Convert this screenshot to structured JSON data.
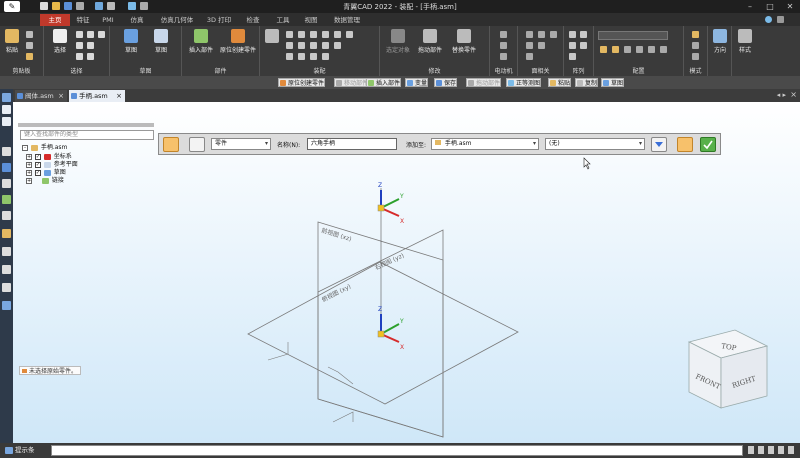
{
  "app": {
    "title": "青翼CAD 2022 - 装配 - [手柄.asm]"
  },
  "ribbon_tabs": [
    "主页",
    "特征",
    "PMI",
    "仿真",
    "仿真几何体",
    "3D 打印",
    "检查",
    "工具",
    "视图",
    "数据管理"
  ],
  "ribbon_groups": {
    "clipboard": {
      "label": "剪贴板",
      "paste": "粘贴"
    },
    "select": {
      "label": "选择",
      "select": "选择"
    },
    "sketch": {
      "label": "草图",
      "sketch": "草图",
      "sketch2": "草图"
    },
    "component": {
      "label": "部件",
      "insert": "插入部件",
      "insert_origin": "原位创建零件"
    },
    "assemble": {
      "label": "装配"
    },
    "modify": {
      "label": "修改",
      "tools": [
        "选定对象",
        "拖动部件",
        "替换零件"
      ]
    },
    "motor": {
      "label": "电动机"
    },
    "face_relate": {
      "label": "面相关"
    },
    "pattern": {
      "label": "阵列"
    },
    "config": {
      "label": "配置"
    },
    "style": {
      "label": "样式",
      "direction": "方向",
      "model": "模式"
    }
  },
  "toolbar2": [
    "原位创建零件",
    "移动部件",
    "插入部件",
    "变量",
    "保存",
    "拖动部件",
    "正等测图",
    "粘贴",
    "复制",
    "草图"
  ],
  "doc_tabs": [
    {
      "label": "阀体.asm"
    },
    {
      "label": "手柄.asm"
    }
  ],
  "tree": {
    "search_placeholder": "键入查找部件的类型",
    "root": "手柄.asm",
    "items": [
      "坐标系",
      "参考平面",
      "草图",
      "链接"
    ],
    "hint": "未选择原始零件。"
  },
  "command_bar": {
    "type_value": "零件",
    "name_label": "名称(N):",
    "name_value": "六角手柄",
    "add_to_label": "添加至:",
    "add_to_value": "手柄.asm",
    "extra_value": "(无)"
  },
  "viewport": {
    "plane_labels": [
      "前视图 (xz)",
      "右视图 (yz)",
      "俯视图 (xy)"
    ],
    "view_cube": {
      "top": "TOP",
      "front": "FRONT",
      "right": "RIGHT"
    }
  },
  "status": {
    "label": "提示条"
  },
  "colors": {
    "accent": "#c0392b",
    "axis_x": "#d62b2b",
    "axis_y": "#2ca02c",
    "axis_z": "#1f3fbf"
  }
}
